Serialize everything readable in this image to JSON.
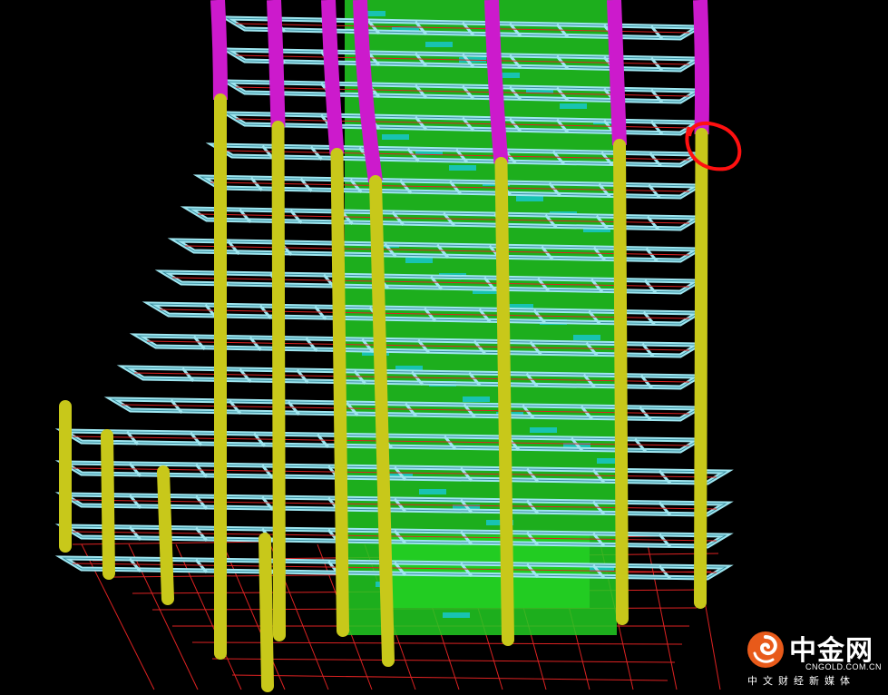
{
  "viewport": {
    "name": "3d-structural-model-view",
    "background_color": "#000000",
    "colors": {
      "beam": "#9fe6f0",
      "beam_edge": "#3a8fa0",
      "column_upper": "#cc1acc",
      "column_lower": "#c8c81a",
      "core_wall": "#22cc22",
      "core_accent": "#18c8d8",
      "grid_line": "#dd2222",
      "highlight_circle": "#ff1010"
    },
    "highlight_annotation": "red-circle-around-column-transition"
  },
  "watermark": {
    "brand": "中金网",
    "site": "CNGOLD.COM.CN",
    "tagline": "中文财经新媒体",
    "logo_icon": "swirl-logo-icon",
    "logo_color": "#e85a1a"
  }
}
